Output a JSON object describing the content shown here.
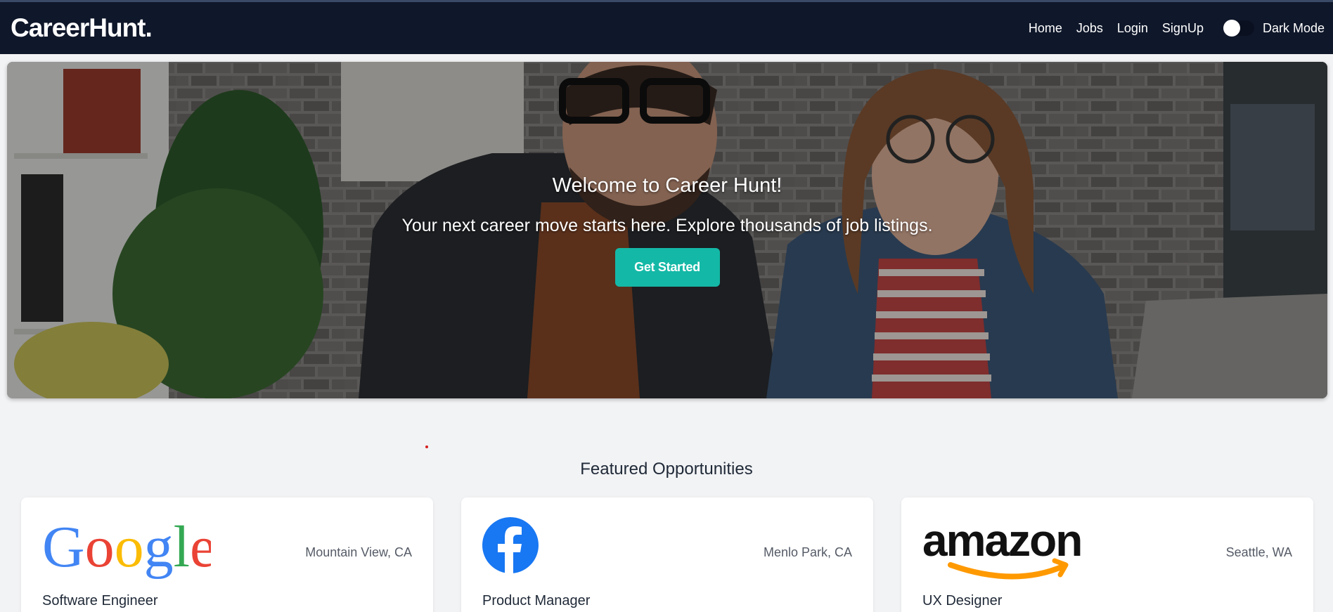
{
  "navbar": {
    "brand": "CareerHunt.",
    "links": [
      "Home",
      "Jobs",
      "Login",
      "SignUp"
    ],
    "dark_mode_label": "Dark Mode"
  },
  "hero": {
    "title": "Welcome to Career Hunt!",
    "subtitle": "Your next career move starts here. Explore thousands of job listings.",
    "cta": "Get Started"
  },
  "featured": {
    "title": "Featured Opportunities",
    "jobs": [
      {
        "company_logo": "google-logo",
        "location": "Mountain View, CA",
        "role": "Software Engineer"
      },
      {
        "company_logo": "facebook-logo",
        "location": "Menlo Park, CA",
        "role": "Product Manager"
      },
      {
        "company_logo": "amazon-logo",
        "location": "Seattle, WA",
        "role": "UX Designer"
      }
    ]
  },
  "colors": {
    "navbar_bg": "#0f172a",
    "accent": "#14b8a6",
    "page_bg": "#f2f3f5"
  }
}
